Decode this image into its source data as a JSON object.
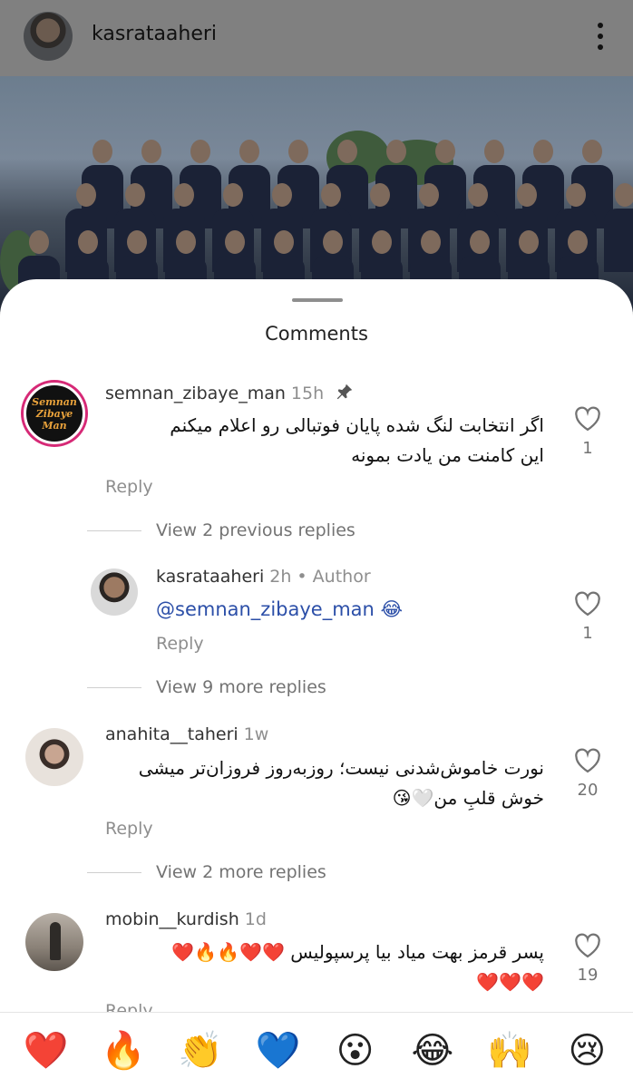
{
  "post": {
    "username": "kasrataaheri"
  },
  "sheet": {
    "title": "Comments"
  },
  "comments": [
    {
      "username": "semnan_zibaye_man",
      "time": "15h",
      "avatar_text": [
        "Semnan",
        "Zibaye",
        "Man"
      ],
      "lines": [
        "اگر انتخابت لنگ شده پایان فوتبالی رو اعلام میکنم",
        "این کامنت من یادت بمونه"
      ],
      "reply_label": "Reply",
      "likes": "1",
      "pinned": true
    },
    {
      "username": "anahita__taheri",
      "time": "1w",
      "lines": [
        "نورت خاموش‌شدنی نیست؛ روزبه‌روز فروزان‌تر میشی",
        "خوش قلبِ من🤍😘"
      ],
      "reply_label": "Reply",
      "likes": "20"
    },
    {
      "username": "mobin__kurdish",
      "time": "1d",
      "lines": [
        "پسر قرمز بهت میاد بیا پرسپولیس ❤️❤️🔥🔥❤️",
        "❤️❤️❤️"
      ],
      "reply_label": "Reply",
      "likes": "19"
    }
  ],
  "replies": {
    "view_previous": "View 2 previous replies",
    "author_reply": {
      "username": "kasrataaheri",
      "time": "2h",
      "author_label": "• Author",
      "mention": "@semnan_zibaye_man 😂",
      "reply_label": "Reply",
      "likes": "1"
    },
    "view_more_1": "View 9 more replies",
    "view_more_2": "View 2 more replies"
  },
  "emoji_bar": [
    "❤️",
    "🔥",
    "👏",
    "💙",
    "😮",
    "😂",
    "🙌",
    "😢"
  ],
  "colors": {
    "mention": "#2c4fa8",
    "muted": "#8e8e8e",
    "story_ring": "#d62976"
  },
  "icons": [
    "more-vertical-icon",
    "pin-icon",
    "heart-outline-icon"
  ]
}
